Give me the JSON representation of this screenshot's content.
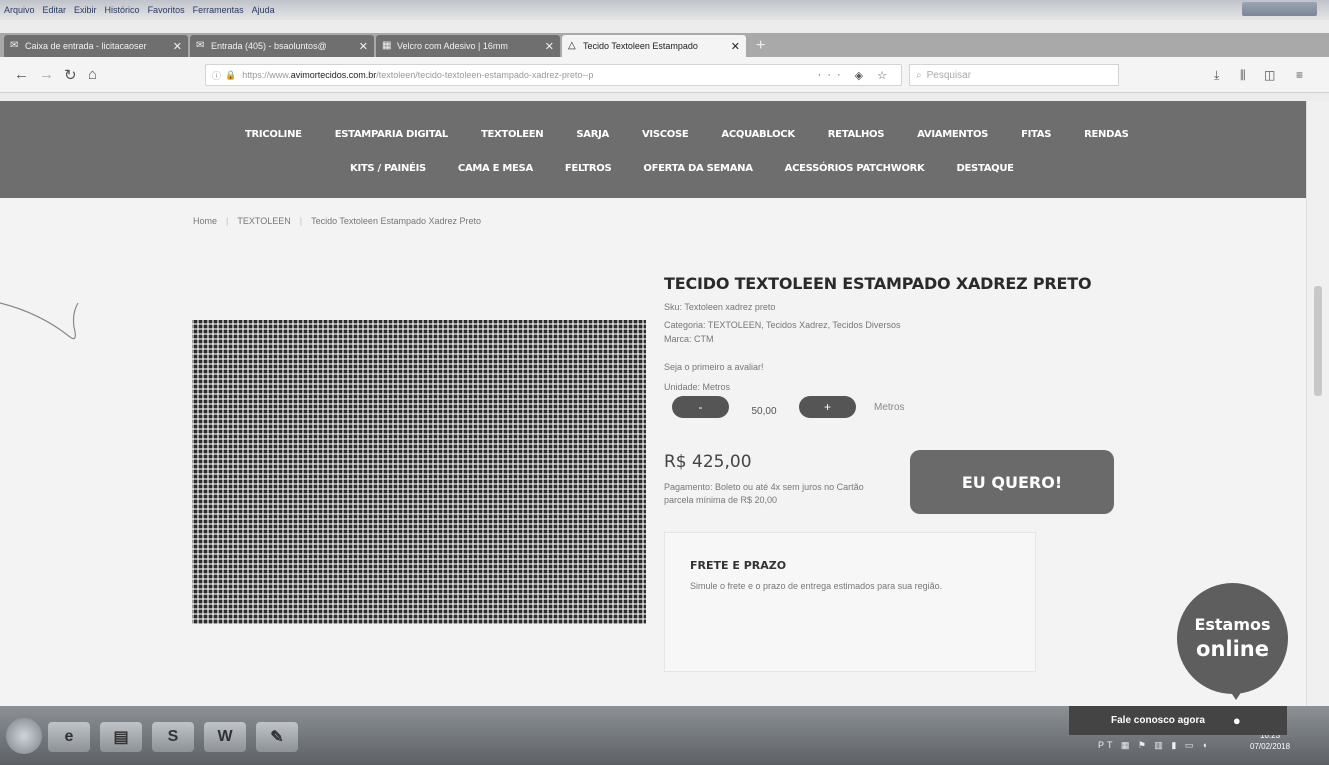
{
  "browser": {
    "menu": [
      "Arquivo",
      "Editar",
      "Exibir",
      "Histórico",
      "Favoritos",
      "Ferramentas",
      "Ajuda"
    ],
    "tabs": [
      {
        "label": "Caixa de entrada - licitacaoser",
        "icon": "mail-icon",
        "active": false
      },
      {
        "label": "Entrada (405) - bsaoluntos@",
        "icon": "mail-icon",
        "active": false
      },
      {
        "label": "Velcro com Adesivo | 16mm",
        "icon": "store-icon",
        "active": false
      },
      {
        "label": "Tecido Textoleen Estampado",
        "icon": "warning-icon",
        "active": true
      }
    ],
    "new_tab": "+",
    "url_prefix": "https://www.",
    "url_domain": "avimortecidos.com.br",
    "url_path": "/textoleen/tecido-textoleen-estampado-xadrez-preto--p",
    "search_placeholder": "Pesquisar"
  },
  "site_nav": {
    "row1": [
      "TRICOLINE",
      "ESTAMPARIA DIGITAL",
      "TEXTOLEEN",
      "SARJA",
      "VISCOSE",
      "ACQUABLOCK",
      "RETALHOS",
      "AVIAMENTOS",
      "FITAS",
      "RENDAS"
    ],
    "row2": [
      "KITS / PAINÉIS",
      "CAMA E MESA",
      "FELTROS",
      "OFERTA DA SEMANA",
      "ACESSÓRIOS PATCHWORK",
      "DESTAQUE"
    ]
  },
  "breadcrumb": [
    "Home",
    "TEXTOLEEN",
    "Tecido Textoleen Estampado Xadrez Preto"
  ],
  "product": {
    "title": "TECIDO TEXTOLEEN ESTAMPADO XADREZ PRETO",
    "sku": "Sku: Textoleen xadrez preto",
    "category": "Categoria: TEXTOLEEN,  Tecidos Xadrez,  Tecidos Diversos",
    "brand": "Marca: CTM",
    "review_prompt": "Seja o primeiro a avaliar!",
    "unit_label": "Unidade: Metros",
    "qty_minus": "-",
    "qty_value": "50,00",
    "qty_plus": "+",
    "qty_unit": "Metros",
    "price": "R$ 425,00",
    "payment": "Pagamento: Boleto ou até 4x sem juros no Cartão parcela mínima de R$ 20,00",
    "buy_label": "EU QUERO!"
  },
  "shipping": {
    "title": "FRETE E PRAZO",
    "description": "Simule o frete e o prazo de entrega estimados para sua região."
  },
  "chat": {
    "bubble_line1": "Estamos",
    "bubble_line2": "online",
    "bar_label": "Fale conosco agora"
  },
  "taskbar": {
    "apps": [
      "S",
      "W"
    ],
    "lang": "PT",
    "time": "10:23",
    "date": "07/02/2018"
  }
}
